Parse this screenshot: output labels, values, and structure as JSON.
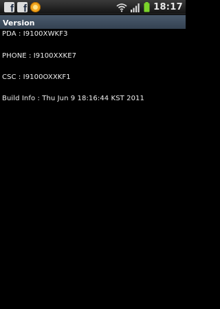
{
  "status_bar": {
    "notification_icons": [
      "facebook-icon",
      "facebook-icon",
      "sync-icon"
    ],
    "system_icons": [
      "wifi-icon",
      "signal-icon",
      "battery-icon"
    ],
    "battery_color": "#7bd32a",
    "time": "18:17"
  },
  "title_bar": {
    "title": "Version"
  },
  "version_info": {
    "pda": "PDA : I9100XWKF3",
    "phone": "PHONE : I9100XXKE7",
    "csc": "CSC : I9100OXXKF1",
    "build_info": "Build Info : Thu Jun  9 18:16:44 KST 2011"
  }
}
